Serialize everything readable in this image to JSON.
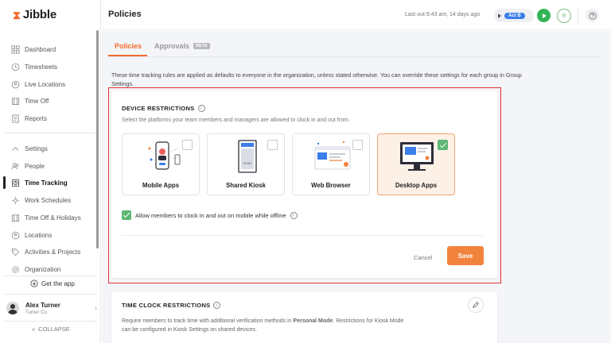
{
  "app": {
    "name": "Jibble"
  },
  "sidebar": {
    "items": [
      {
        "label": "Dashboard",
        "icon": "grid-icon"
      },
      {
        "label": "Timesheets",
        "icon": "clock-icon"
      },
      {
        "label": "Live Locations",
        "icon": "location-icon"
      },
      {
        "label": "Time Off",
        "icon": "calendar-icon"
      },
      {
        "label": "Reports",
        "icon": "report-icon"
      },
      {
        "label": "Settings",
        "icon": "chevron-up-icon"
      },
      {
        "label": "People",
        "icon": "people-icon"
      },
      {
        "label": "Time Tracking",
        "icon": "time-tracking-icon",
        "active": true
      },
      {
        "label": "Work Schedules",
        "icon": "schedule-icon"
      },
      {
        "label": "Time Off & Holidays",
        "icon": "holiday-icon"
      },
      {
        "label": "Locations",
        "icon": "pin-icon"
      },
      {
        "label": "Activities & Projects",
        "icon": "tag-icon"
      },
      {
        "label": "Organization",
        "icon": "gear-icon"
      }
    ],
    "get_app": "Get the app",
    "user": {
      "name": "Alex Turner",
      "org": "Turner Co"
    },
    "collapse": "COLLAPSE"
  },
  "header": {
    "title": "Policies",
    "last_out": "Last out 6:43 am, 14 days ago",
    "activity_badge": "Act B",
    "avatar_initial": "R"
  },
  "tabs": [
    {
      "label": "Policies",
      "active": true
    },
    {
      "label": "Approvals",
      "badge": "BETA"
    }
  ],
  "intro": "These time tracking rules are applied as defaults to everyone in the organization, unless stated otherwise. You can override these settings for each group in Group Settings.",
  "device_restrictions": {
    "title": "DEVICE RESTRICTIONS",
    "description": "Select the platforms your team members and managers are allowed to clock in and out from.",
    "options": [
      {
        "label": "Mobile Apps",
        "checked": false
      },
      {
        "label": "Shared Kiosk",
        "checked": false
      },
      {
        "label": "Web Browser",
        "checked": false
      },
      {
        "label": "Desktop Apps",
        "checked": true
      }
    ],
    "offline_label": "Allow members to clock in and out on mobile while offline",
    "offline_checked": true,
    "cancel": "Cancel",
    "save": "Save"
  },
  "time_clock_restrictions": {
    "title": "TIME CLOCK RESTRICTIONS",
    "description_pre": "Require members to track time with additional verification methods in ",
    "description_bold": "Personal Mode",
    "description_post": ". Restrictions for Kiosk Mode can be configured in Kiosk Settings on shared devices."
  },
  "colors": {
    "brand": "#f26b2f",
    "accent": "#f2833d",
    "success": "#5bb772",
    "highlight": "#e0333a",
    "badge": "#3b7de9"
  }
}
